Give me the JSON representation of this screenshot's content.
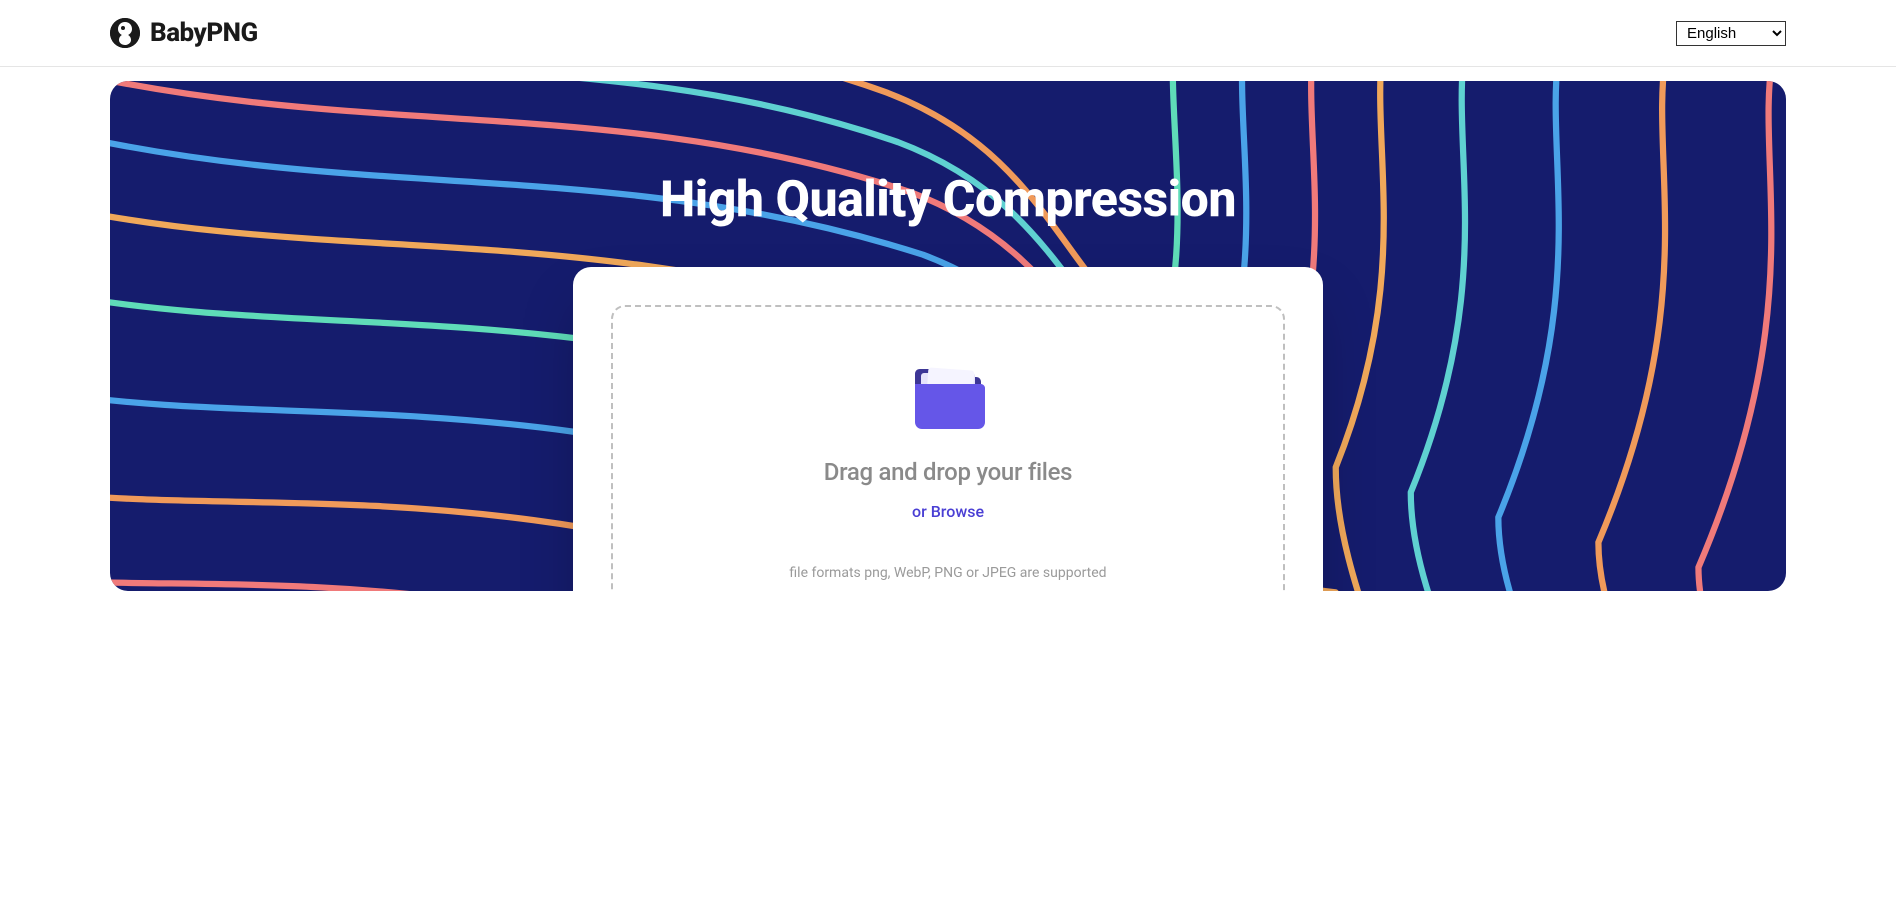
{
  "header": {
    "brand": "BabyPNG",
    "language_selected": "English",
    "language_options": [
      "English"
    ]
  },
  "hero": {
    "title": "High Quality Compression"
  },
  "upload": {
    "drop_text": "Drag and drop your files",
    "browse_text": "or Browse",
    "formats_text": "file formats png, WebP, PNG or JPEG are supported"
  },
  "colors": {
    "hero_bg": "#151c6d",
    "accent": "#4a3fd4",
    "folder_front": "#6556e8",
    "folder_back": "#3d3696"
  }
}
